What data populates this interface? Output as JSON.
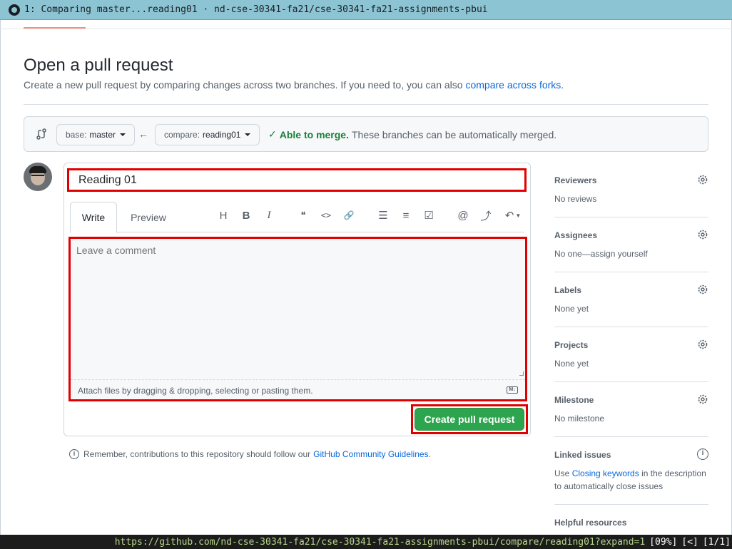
{
  "window": {
    "title": "1: Comparing master...reading01 · nd-cse-30341-fa21/cse-30341-fa21-assignments-pbui"
  },
  "header": {
    "title": "Open a pull request",
    "subtitle_text": "Create a new pull request by comparing changes across two branches. If you need to, you can also ",
    "subtitle_link": "compare across forks",
    "subtitle_end": "."
  },
  "range": {
    "base_label": "base:",
    "base_value": "master",
    "compare_label": "compare:",
    "compare_value": "reading01",
    "arrow": "←",
    "merge_status": "Able to merge.",
    "merge_note": "These branches can be automatically merged."
  },
  "form": {
    "title_value": "Reading 01",
    "tabs": [
      {
        "label": "Write"
      },
      {
        "label": "Preview"
      }
    ],
    "toolbar": [
      {
        "icon": "heading-icon",
        "glyph": "H"
      },
      {
        "icon": "bold-icon",
        "glyph": "B"
      },
      {
        "icon": "italic-icon",
        "glyph": "I"
      },
      {
        "icon": "quote-icon",
        "glyph": "❝"
      },
      {
        "icon": "code-icon",
        "glyph": "<>"
      },
      {
        "icon": "link-icon",
        "glyph": "🔗"
      },
      {
        "icon": "unordered-list-icon",
        "glyph": "☰"
      },
      {
        "icon": "ordered-list-icon",
        "glyph": "≡"
      },
      {
        "icon": "task-list-icon",
        "glyph": "☑"
      },
      {
        "icon": "mention-icon",
        "glyph": "@"
      },
      {
        "icon": "cross-reference-icon",
        "glyph": "⤴"
      },
      {
        "icon": "reply-icon",
        "glyph": "↶"
      }
    ],
    "comment_placeholder": "Leave a comment",
    "attach_text": "Attach files by dragging & dropping, selecting or pasting them.",
    "markdown_badge": "M↓",
    "submit_label": "Create pull request"
  },
  "reminder": {
    "text": "Remember, contributions to this repository should follow our",
    "link": "GitHub Community Guidelines",
    "end": "."
  },
  "sidebar": {
    "reviewers": {
      "title": "Reviewers",
      "value": "No reviews"
    },
    "assignees": {
      "title": "Assignees",
      "value": "No one—assign yourself"
    },
    "labels": {
      "title": "Labels",
      "value": "None yet"
    },
    "projects": {
      "title": "Projects",
      "value": "None yet"
    },
    "milestone": {
      "title": "Milestone",
      "value": "No milestone"
    },
    "linked_issues": {
      "title": "Linked issues",
      "text_before": "Use ",
      "link": "Closing keywords",
      "text_after": " in the description",
      "line2": "to automatically close issues"
    },
    "helpful": {
      "title": "Helpful resources"
    }
  },
  "statusbar": {
    "url": "https://github.com/nd-cse-30341-fa21/cse-30341-fa21-assignments-pbui/compare/reading01?expand=1",
    "progress": "[09%]",
    "nav": "[<]",
    "page": "[1/1]"
  },
  "colors": {
    "primary_button": "#2da44e",
    "link": "#0969da",
    "highlight_border": "#e10000",
    "titlebar": "#8cc4d4"
  }
}
